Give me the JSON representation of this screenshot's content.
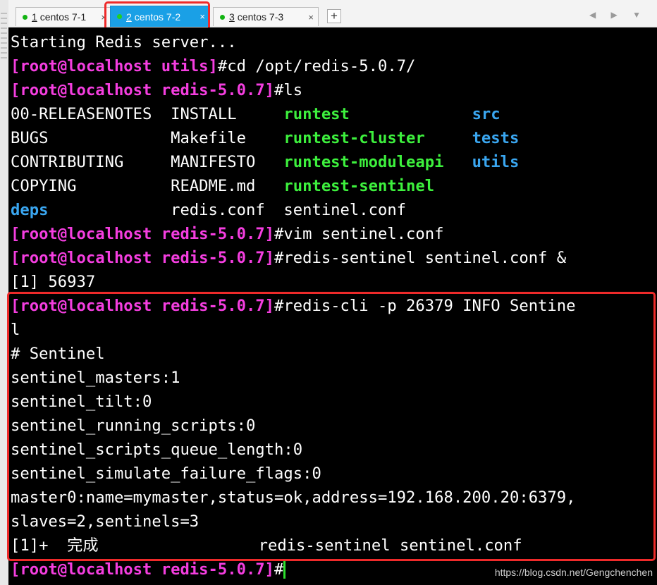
{
  "tabs": [
    {
      "num": "1",
      "label": "centos 7-1",
      "active": false
    },
    {
      "num": "2",
      "label": "centos 7-2",
      "active": true
    },
    {
      "num": "3",
      "label": "centos 7-3",
      "active": false
    }
  ],
  "tab_close": "×",
  "new_tab": "+",
  "nav_arrows": "◀ ▶ ▼",
  "terminal": {
    "lines": [
      [
        {
          "t": "Starting Redis server..."
        }
      ],
      [
        {
          "t": "[root@localhost utils]",
          "c": "p"
        },
        {
          "t": "#cd /opt/redis-5.0.7/"
        }
      ],
      [
        {
          "t": "[root@localhost redis-5.0.7]",
          "c": "p"
        },
        {
          "t": "#ls"
        }
      ],
      [
        {
          "t": "00-RELEASENOTES  INSTALL     "
        },
        {
          "t": "runtest",
          "c": "g"
        },
        {
          "t": "             "
        },
        {
          "t": "src",
          "c": "b"
        }
      ],
      [
        {
          "t": "BUGS             Makefile    "
        },
        {
          "t": "runtest-cluster",
          "c": "g"
        },
        {
          "t": "     "
        },
        {
          "t": "tests",
          "c": "b"
        }
      ],
      [
        {
          "t": "CONTRIBUTING     MANIFESTO   "
        },
        {
          "t": "runtest-moduleapi",
          "c": "g"
        },
        {
          "t": "   "
        },
        {
          "t": "utils",
          "c": "b"
        }
      ],
      [
        {
          "t": "COPYING          README.md   "
        },
        {
          "t": "runtest-sentinel",
          "c": "g"
        }
      ],
      [
        {
          "t": "deps",
          "c": "b"
        },
        {
          "t": "             redis.conf  sentinel.conf"
        }
      ],
      [
        {
          "t": "[root@localhost redis-5.0.7]",
          "c": "p"
        },
        {
          "t": "#vim sentinel.conf"
        }
      ],
      [
        {
          "t": "[root@localhost redis-5.0.7]",
          "c": "p"
        },
        {
          "t": "#redis-sentinel sentinel.conf &"
        }
      ],
      [
        {
          "t": "[1] 56937"
        }
      ],
      [
        {
          "t": "[root@localhost redis-5.0.7]",
          "c": "p"
        },
        {
          "t": "#redis-cli -p 26379 INFO Sentine"
        }
      ],
      [
        {
          "t": "l"
        }
      ],
      [
        {
          "t": "# Sentinel"
        }
      ],
      [
        {
          "t": "sentinel_masters:1"
        }
      ],
      [
        {
          "t": "sentinel_tilt:0"
        }
      ],
      [
        {
          "t": "sentinel_running_scripts:0"
        }
      ],
      [
        {
          "t": "sentinel_scripts_queue_length:0"
        }
      ],
      [
        {
          "t": "sentinel_simulate_failure_flags:0"
        }
      ],
      [
        {
          "t": "master0:name=mymaster,status=ok,address=192.168.200.20:6379,"
        }
      ],
      [
        {
          "t": "slaves=2,sentinels=3"
        }
      ],
      [
        {
          "t": "[1]+  完成                 redis-sentinel sentinel.conf"
        }
      ],
      [
        {
          "t": "[root@localhost redis-5.0.7]",
          "c": "p"
        },
        {
          "t": "#"
        }
      ]
    ]
  },
  "watermark": "https://blog.csdn.net/Gengchenchen",
  "colors": {
    "prompt": "#f53ee0",
    "executable": "#3df03d",
    "directory": "#3aa6f0",
    "active_tab": "#1aa0e6",
    "highlight": "#ee2a2a"
  }
}
